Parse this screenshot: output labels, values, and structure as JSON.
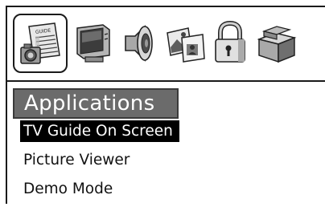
{
  "toolbar": {
    "icons": [
      {
        "name": "guide-camera-icon",
        "selected": true,
        "label_text": "GUIDE"
      },
      {
        "name": "tv-monitor-icon",
        "selected": false
      },
      {
        "name": "speaker-icon",
        "selected": false
      },
      {
        "name": "pictures-icon",
        "selected": false
      },
      {
        "name": "lock-icon",
        "selected": false
      },
      {
        "name": "box-icon",
        "selected": false
      }
    ]
  },
  "section": {
    "title": "Applications"
  },
  "menu": {
    "items": [
      {
        "label": "TV Guide On Screen",
        "selected": true
      },
      {
        "label": "Picture Viewer",
        "selected": false
      },
      {
        "label": "Demo Mode",
        "selected": false
      }
    ]
  },
  "colors": {
    "heading_bg": "#6b6b6b",
    "selected_bg": "#000000",
    "text": "#111111"
  }
}
